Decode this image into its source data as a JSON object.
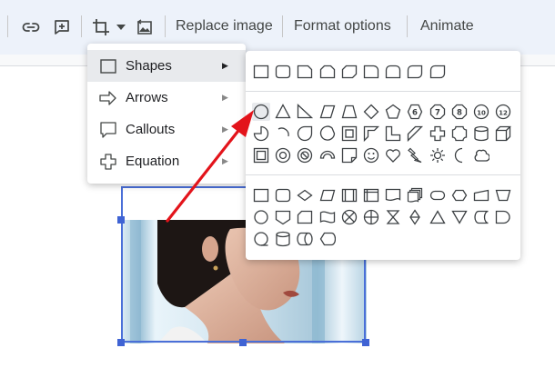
{
  "toolbar": {
    "replace_image": "Replace image",
    "format_options": "Format options",
    "animate": "Animate"
  },
  "menu": {
    "items": [
      {
        "label": "Shapes",
        "icon": "square-icon"
      },
      {
        "label": "Arrows",
        "icon": "arrow-right-icon"
      },
      {
        "label": "Callouts",
        "icon": "callout-icon"
      },
      {
        "label": "Equation",
        "icon": "plus-icon"
      }
    ]
  },
  "palette": {
    "number_badges": [
      "6",
      "7",
      "8",
      "10",
      "12"
    ]
  },
  "colors": {
    "annotation_arrow": "#e3141b",
    "selection": "#4a6fd8",
    "toolbar_bg": "#edf2fa"
  }
}
